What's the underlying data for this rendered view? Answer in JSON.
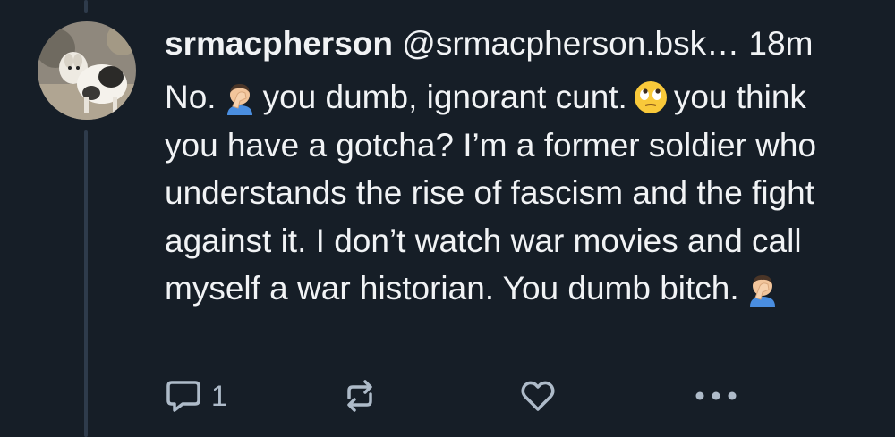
{
  "post": {
    "author_name": "srmacpherson",
    "author_handle": "@srmacpherson.bsk…",
    "timestamp": "18m",
    "body": [
      "No.",
      "you dumb, ignorant cunt.",
      "you think you have a gotcha? I’m a former soldier who understands the rise of fascism and the fight against it. I don’t watch war movies and call myself a war historian. You dumb bitch."
    ],
    "emoji": [
      "facepalm",
      "eye-roll",
      "facepalm"
    ]
  },
  "actions": {
    "reply_count": "1",
    "icons": [
      "reply-icon",
      "repost-icon",
      "like-icon",
      "more-icon"
    ]
  },
  "colors": {
    "background": "#161e27",
    "text": "#f1f3f5",
    "muted": "#aebbc9",
    "thread_line": "#2e3b4b"
  }
}
